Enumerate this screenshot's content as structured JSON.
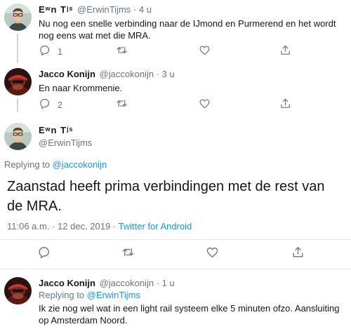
{
  "tweets": [
    {
      "display_name": "Eʷn Tʲˢ",
      "handle": "@ErwinTijms",
      "separator": "·",
      "time": "4 u",
      "text": "Nu nog een snelle verbinding naar de IJmond en Purmerend en het wordt nog eens wat met die MRA.",
      "replies": "1"
    },
    {
      "display_name": "Jacco Konijn",
      "handle": "@jaccokonijn",
      "separator": "·",
      "time": "3 u",
      "text": "En naar Krommenie.",
      "replies": "2"
    }
  ],
  "main": {
    "display_name": "Eʷn Tʲˢ",
    "handle": "@ErwinTijms",
    "replying_label": "Replying to",
    "replying_handle": "@jaccokonijn",
    "text": "Zaanstad heeft prima verbindingen met de rest van de MRA.",
    "timestamp": "11:06 a.m. · 12 dec. 2019 · ",
    "source": "Twitter for Android"
  },
  "reply": {
    "display_name": "Jacco Konijn",
    "handle": "@jaccokonijn",
    "separator": "·",
    "time": "1 u",
    "replying_label": "Replying to",
    "replying_handle": "@ErwinTijms",
    "text": "Ik zie nog wel wat in een light rail systeem elke 5 minuten ofzo. Aansluiting op Amsterdam Noord."
  },
  "icons": {
    "reply": "reply-icon",
    "retweet": "retweet-icon",
    "like": "heart-icon",
    "share": "share-icon"
  },
  "colors": {
    "link": "#1b95e0",
    "secondary_text": "#657786",
    "thread_line": "#ccd6dd"
  }
}
